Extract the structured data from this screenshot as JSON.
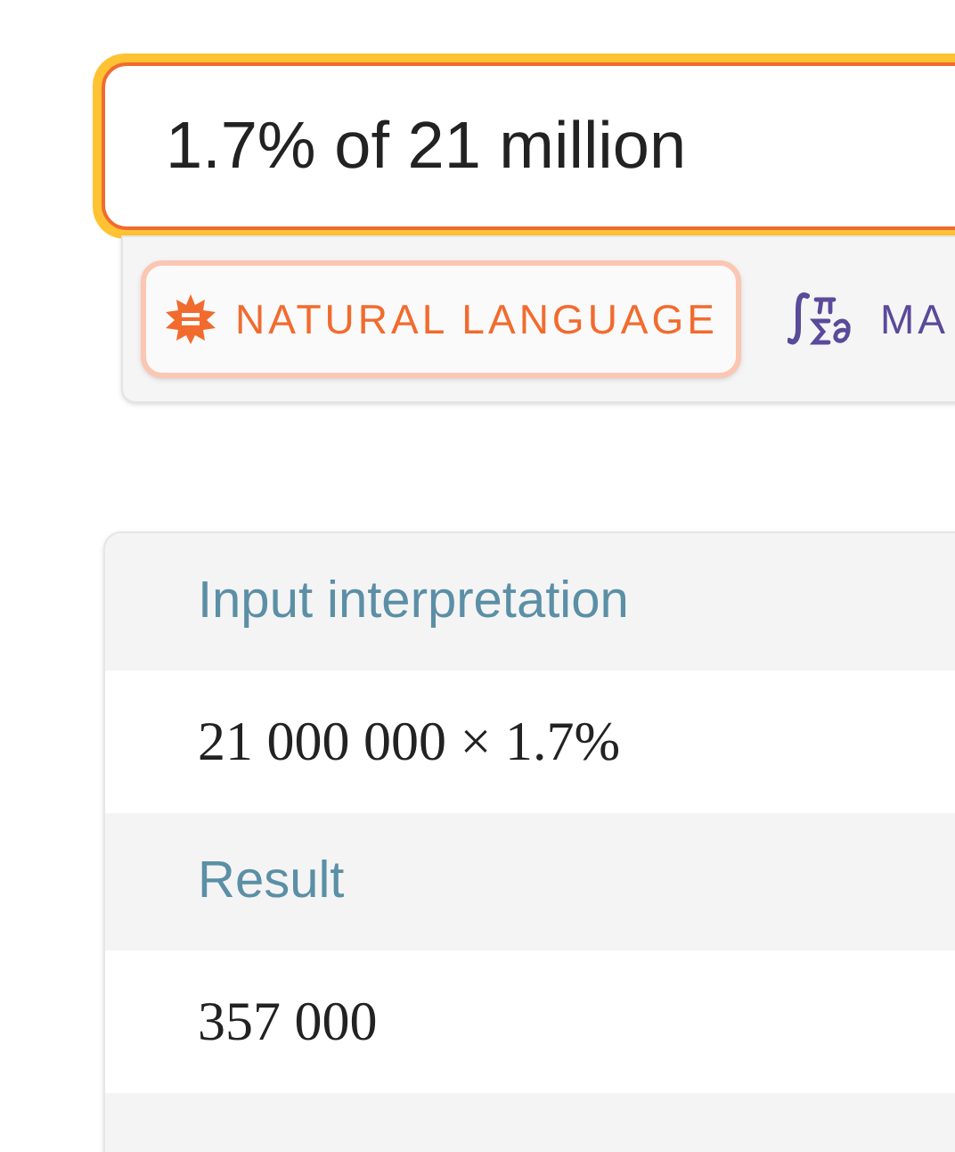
{
  "search": {
    "value": "1.7% of 21 million"
  },
  "modes": [
    {
      "label": "NATURAL LANGUAGE",
      "kind": "natural",
      "selected": true
    },
    {
      "label": "MA",
      "kind": "math",
      "selected": false
    }
  ],
  "pods": [
    {
      "title": "Input interpretation",
      "value": "21 000 000 × 1.7%"
    },
    {
      "title": "Result",
      "value": "357 000"
    }
  ]
}
